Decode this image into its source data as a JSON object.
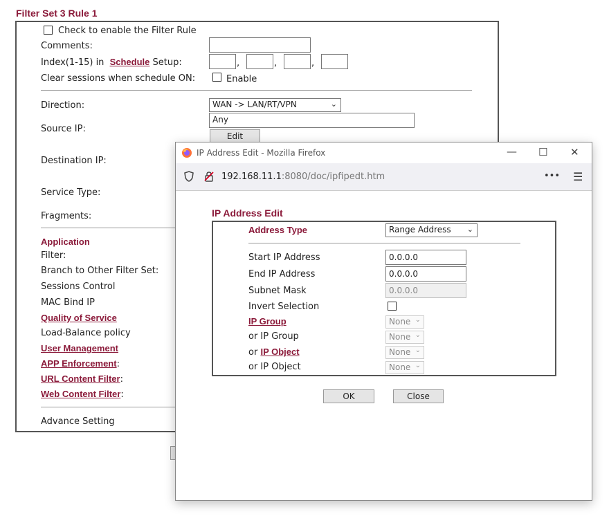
{
  "page": {
    "title": "Filter Set 3 Rule 1",
    "enable_label": "Check to enable the Filter Rule",
    "comments_label": "Comments:",
    "index_prefix": "Index(1-15) in",
    "schedule_link": "Schedule",
    "index_suffix": "Setup:",
    "comma": ",",
    "clear_sessions_label": "Clear sessions when schedule ON:",
    "clear_enable_label": "Enable",
    "direction_label": "Direction:",
    "direction_value": "WAN -> LAN/RT/VPN",
    "source_ip_label": "Source IP:",
    "source_ip_value": "Any",
    "edit_button": "Edit",
    "destination_ip_label": "Destination IP:",
    "service_type_label": "Service Type:",
    "fragments_label": "Fragments:",
    "application_heading": "Application",
    "filter_label": "Filter:",
    "branch_label": "Branch to Other Filter Set:",
    "sessions_label": "Sessions Control",
    "mac_bind_label": "MAC Bind IP",
    "qos_link": "Quality of Service",
    "load_balance_label": "Load-Balance policy",
    "user_mgmt_link": "User Management",
    "app_enf_link": "APP Enforcement",
    "url_filter_link": "URL Content Filter",
    "web_filter_link": "Web Content Filter",
    "colon": ":",
    "advance_label": "Advance Setting"
  },
  "popup": {
    "window_title": "IP Address Edit - Mozilla Firefox",
    "url_host": "192.168.11.1",
    "url_rest": ":8080/doc/ipfipedt.htm",
    "more_glyph": "•••",
    "menu_glyph": "☰",
    "heading": "IP Address Edit",
    "address_type_label": "Address Type",
    "address_type_value": "Range Address",
    "start_ip_label": "Start IP Address",
    "start_ip_value": "0.0.0.0",
    "end_ip_label": "End IP Address",
    "end_ip_value": "0.0.0.0",
    "subnet_label": "Subnet Mask",
    "subnet_value": "0.0.0.0",
    "invert_label": "Invert Selection",
    "ip_group_link": "IP Group",
    "or_prefix": "or",
    "or_ip_group_label": "or IP Group",
    "ip_object_link": "IP Object",
    "or_ip_object_label": "or IP Object",
    "none_value": "None",
    "ok_button": "OK",
    "close_button": "Close"
  },
  "colors": {
    "accent": "#8b1a3a",
    "border": "#555555"
  }
}
